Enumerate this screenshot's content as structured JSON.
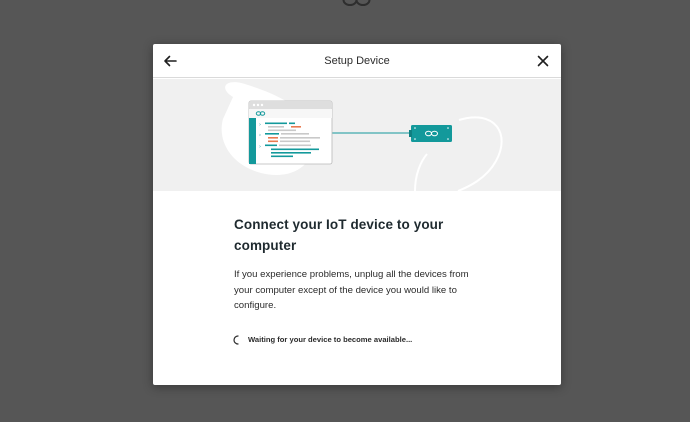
{
  "dialog": {
    "title": "Setup Device",
    "heading": "Connect your IoT device to your computer",
    "description": "If you experience problems, unplug all the devices from your computer except of the device you would like to configure.",
    "status": "Waiting for your device to become available..."
  },
  "icons": {
    "back": "arrow-left-icon",
    "close": "close-icon",
    "spinner": "loading-spinner-icon",
    "logo": "arduino-infinity-icon"
  },
  "colors": {
    "backdrop": "#565656",
    "teal": "#13999b",
    "accent_orange": "#e97a4f",
    "illustration_bg": "#f0f0f0"
  }
}
